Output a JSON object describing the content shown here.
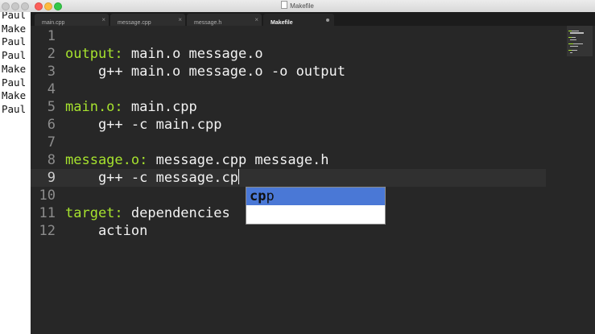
{
  "window": {
    "title": "Makefile"
  },
  "terminal": {
    "lines": [
      "Paul",
      "Make",
      "Paul",
      "Paul",
      "Make",
      "Paul",
      "Make",
      "Paul"
    ]
  },
  "tabs": [
    {
      "label": "main.cpp",
      "active": false,
      "close": "×"
    },
    {
      "label": "message.cpp",
      "active": false,
      "close": "×"
    },
    {
      "label": "message.h",
      "active": false,
      "close": "×"
    },
    {
      "label": "Makefile",
      "active": true,
      "dirty": true
    }
  ],
  "code": {
    "line_numbers": [
      "1",
      "2",
      "3",
      "4",
      "5",
      "6",
      "7",
      "8",
      "9",
      "10",
      "11",
      "12"
    ],
    "lines": [
      {
        "target": "",
        "rest": ""
      },
      {
        "target": "output:",
        "rest": " main.o message.o"
      },
      {
        "target": "",
        "rest": "    g++ main.o message.o -o output"
      },
      {
        "target": "",
        "rest": ""
      },
      {
        "target": "main.o:",
        "rest": " main.cpp"
      },
      {
        "target": "",
        "rest": "    g++ -c main.cpp"
      },
      {
        "target": "",
        "rest": ""
      },
      {
        "target": "message.o:",
        "rest": " message.cpp message.h"
      },
      {
        "target": "",
        "rest": "    g++ -c message.cp"
      },
      {
        "target": "",
        "rest": ""
      },
      {
        "target": "target:",
        "rest": " dependencies"
      },
      {
        "target": "",
        "rest": "    action"
      }
    ],
    "current_line": "9",
    "keyword_color": "#a6e22e"
  },
  "autocomplete": {
    "item_match": "cp",
    "item_rest": "p",
    "selection_color": "#4a78d6"
  }
}
